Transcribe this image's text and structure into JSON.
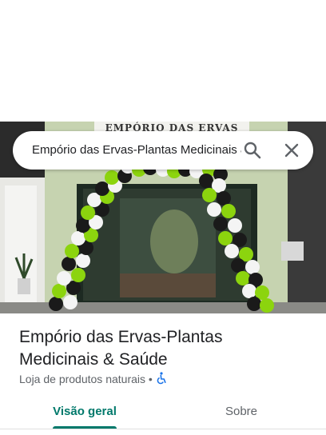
{
  "search": {
    "query": "Empório das Ervas-Plantas Medicinais & Saúde",
    "search_icon": "search-icon",
    "close_icon": "close-icon"
  },
  "photo": {
    "storefront_sign": "EMPÓRIO DAS ERVAS"
  },
  "place": {
    "title_line1": "Empório das Ervas-Plantas",
    "title_line2": "Medicinais & Saúde",
    "category": "Loja de produtos naturais",
    "separator": "•",
    "accessibility_icon": "wheelchair-icon"
  },
  "tabs": [
    {
      "label": "Visão geral",
      "selected": true
    },
    {
      "label": "Sobre",
      "selected": false
    }
  ],
  "colors": {
    "accent": "#00796b",
    "balloon_green": "#8cd40e",
    "balloon_black": "#1a1a1a",
    "balloon_white": "#f4f4f4"
  }
}
